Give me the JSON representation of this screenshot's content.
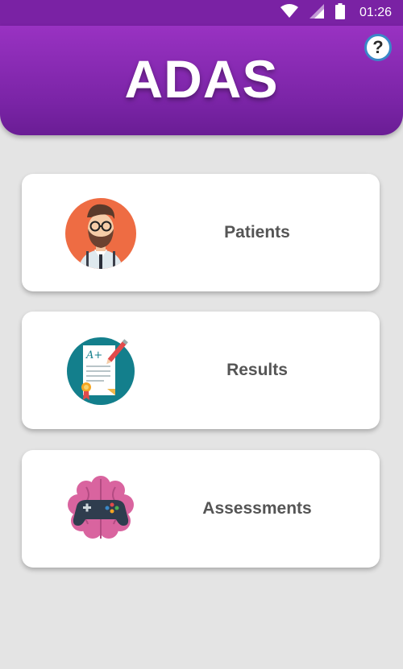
{
  "status_bar": {
    "time": "01:26",
    "icons": [
      "wifi-icon",
      "signal-icon",
      "battery-icon"
    ]
  },
  "header": {
    "title": "ADAS",
    "help_label": "?",
    "colors": {
      "header_top": "#9932c2",
      "header_bottom": "#6a1d95"
    }
  },
  "menu": {
    "items": [
      {
        "label": "Patients",
        "icon": "doctor-avatar-icon"
      },
      {
        "label": "Results",
        "icon": "graded-paper-icon"
      },
      {
        "label": "Assessments",
        "icon": "brain-gamepad-icon"
      }
    ]
  }
}
